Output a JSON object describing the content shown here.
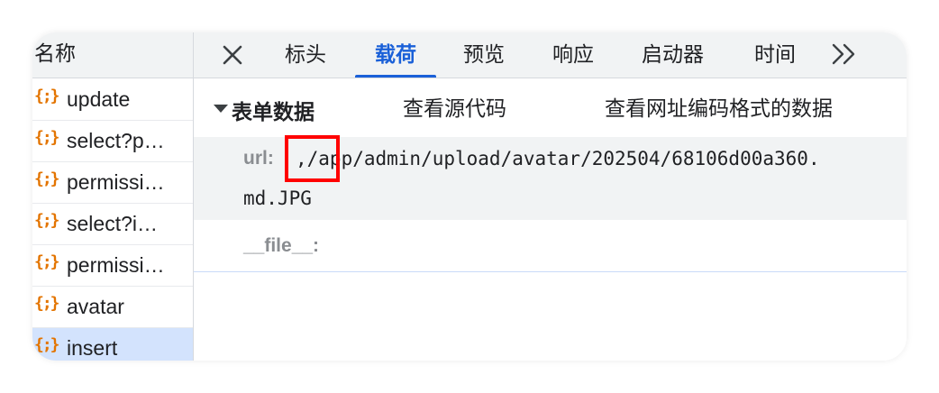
{
  "sidebar": {
    "title": "名称",
    "items": [
      {
        "icon": "{;}",
        "label": "update",
        "selected": false
      },
      {
        "icon": "{;}",
        "label": "select?p…",
        "selected": false
      },
      {
        "icon": "{;}",
        "label": "permissi…",
        "selected": false
      },
      {
        "icon": "{;}",
        "label": "select?i…",
        "selected": false
      },
      {
        "icon": "{;}",
        "label": "permissi…",
        "selected": false
      },
      {
        "icon": "{;}",
        "label": "avatar",
        "selected": false
      },
      {
        "icon": "{;}",
        "label": "insert",
        "selected": true
      }
    ]
  },
  "tabs": {
    "close_icon": "close-icon",
    "items": [
      "标头",
      "载荷",
      "预览",
      "响应",
      "启动器",
      "时间"
    ],
    "active": "载荷",
    "more": ">>"
  },
  "payload": {
    "section_title": "表单数据",
    "view_source": "查看源代码",
    "view_url_encoded": "查看网址编码格式的数据",
    "fields": [
      {
        "key": "url:",
        "value_line1": ",/app/admin/upload/avatar/202504/68106d00a360.",
        "value_line2": "md.JPG"
      },
      {
        "key": "__file__:",
        "value_line1": "",
        "value_line2": ""
      }
    ]
  },
  "colors": {
    "accent": "#1a60d8",
    "json_icon": "#e37400",
    "highlight": "#ff0000",
    "selected_bg": "#d3e3fd"
  }
}
